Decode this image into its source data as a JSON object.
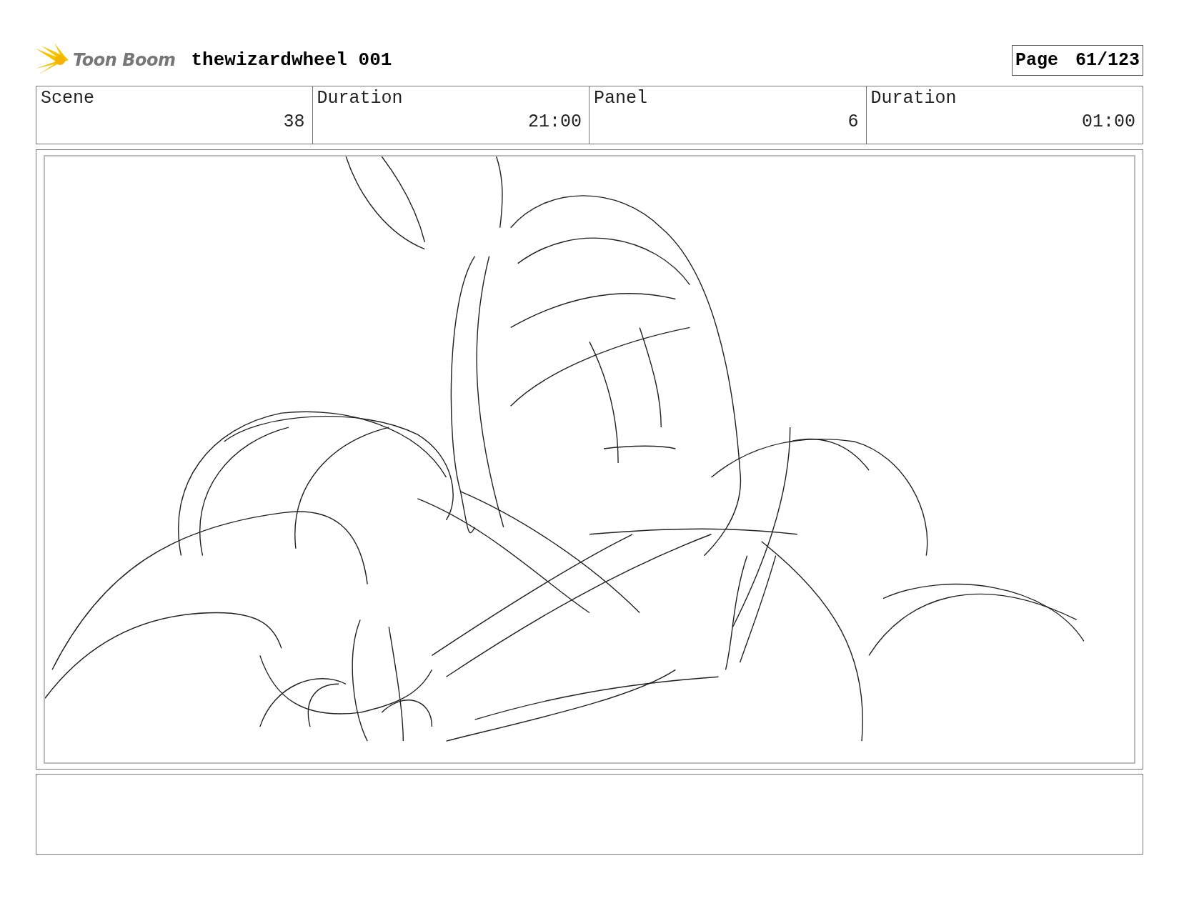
{
  "header": {
    "logo": "Toon Boom",
    "title": "thewizardwheel 001",
    "page_label": "Page",
    "page_number": "61/123"
  },
  "info_table": {
    "columns": [
      "Scene",
      "Duration",
      "Panel",
      "Duration"
    ],
    "rows": [
      [
        "38",
        "21:00",
        "6",
        "01:00"
      ]
    ]
  }
}
